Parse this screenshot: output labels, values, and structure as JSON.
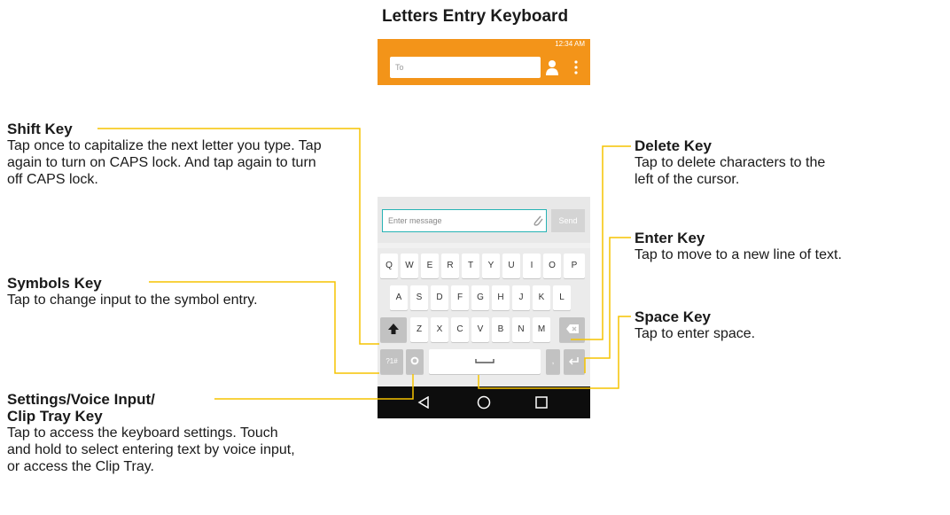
{
  "title": "Letters Entry Keyboard",
  "phone": {
    "status_time": "12:34 AM",
    "to_placeholder": "To",
    "message_placeholder": "Enter message",
    "send_label": "Send",
    "keyboard": {
      "row1": [
        "Q",
        "W",
        "E",
        "R",
        "T",
        "Y",
        "U",
        "I",
        "O",
        "P"
      ],
      "row2": [
        "A",
        "S",
        "D",
        "F",
        "G",
        "H",
        "J",
        "K",
        "L"
      ],
      "row3": [
        "Z",
        "X",
        "C",
        "V",
        "B",
        "N",
        "M"
      ],
      "symbols_label": "?1#",
      "comma_label": ","
    }
  },
  "labels": {
    "shift": {
      "title": "Shift Key",
      "desc": "Tap once to capitalize the next letter you type. Tap again to turn on CAPS lock. And tap again to turn off CAPS lock."
    },
    "symbols": {
      "title": "Symbols Key",
      "desc": "Tap to change input to the symbol entry."
    },
    "settings": {
      "title_line1": "Settings/Voice Input/",
      "title_line2": "Clip Tray Key",
      "desc": "Tap to access the keyboard settings. Touch and hold to select entering text by voice input, or access the Clip Tray."
    },
    "delete": {
      "title": "Delete Key",
      "desc": "Tap to delete characters to the left of the cursor."
    },
    "enter": {
      "title": "Enter Key",
      "desc": "Tap to move to a new line of text."
    },
    "space": {
      "title": "Space Key",
      "desc": "Tap to enter space."
    }
  },
  "colors": {
    "accent": "#f39419",
    "callout_line": "#f6c400",
    "field_border": "#27b3b5"
  }
}
